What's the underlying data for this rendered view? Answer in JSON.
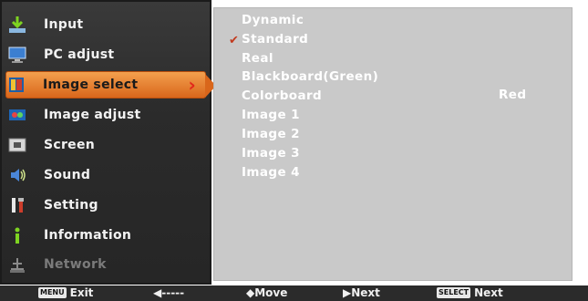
{
  "menu": {
    "items": [
      {
        "label": "Input",
        "icon": "input-icon"
      },
      {
        "label": "PC adjust",
        "icon": "pc-adjust-icon"
      },
      {
        "label": "Image select",
        "icon": "image-select-icon",
        "selected": true
      },
      {
        "label": "Image adjust",
        "icon": "image-adjust-icon"
      },
      {
        "label": "Screen",
        "icon": "screen-icon"
      },
      {
        "label": "Sound",
        "icon": "sound-icon"
      },
      {
        "label": "Setting",
        "icon": "setting-icon"
      },
      {
        "label": "Information",
        "icon": "information-icon"
      },
      {
        "label": "Network",
        "icon": "network-icon",
        "disabled": true
      }
    ]
  },
  "submenu": {
    "items": [
      {
        "label": "Dynamic"
      },
      {
        "label": "Standard",
        "checked": true
      },
      {
        "label": "Real"
      },
      {
        "label": "Blackboard(Green)"
      },
      {
        "label": "Colorboard",
        "value": "Red"
      },
      {
        "label": "Image 1"
      },
      {
        "label": "Image 2"
      },
      {
        "label": "Image 3"
      },
      {
        "label": "Image 4"
      }
    ],
    "check_mark": "✔"
  },
  "status_bar": {
    "menu_key": "MENU",
    "exit_label": "Exit",
    "back_label": "◀-----",
    "move_label": "◆Move",
    "next_arrow_label": "▶Next",
    "select_key": "SELECT",
    "select_next_label": "Next"
  },
  "colors": {
    "highlight": "#e27a2c",
    "panel_bg": "#c9c9c9",
    "menu_bg": "#2e2e2e",
    "check": "#c23a1e"
  }
}
